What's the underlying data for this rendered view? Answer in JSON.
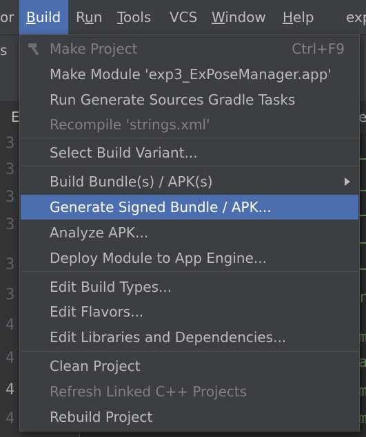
{
  "menubar": {
    "items": [
      {
        "label": "or"
      },
      {
        "label": "Build",
        "underline": "B",
        "rest": "uild"
      },
      {
        "label": "Run",
        "pre": "R",
        "underline": "u",
        "rest": "n"
      },
      {
        "label": "Tools",
        "underline": "T",
        "rest": "ools"
      },
      {
        "label": "VCS"
      },
      {
        "label": "Window",
        "underline": "W",
        "rest": "indow"
      },
      {
        "label": "Help",
        "underline": "H",
        "rest": "elp"
      },
      {
        "label": "exp"
      }
    ]
  },
  "background": {
    "breadcrumb_fragment": "s",
    "tab_fragment": "E",
    "right_fragment": "e",
    "gutter_lines": [
      "3",
      "3",
      "3",
      "3",
      "3",
      "3",
      "4",
      "4",
      "4",
      "4",
      "4"
    ],
    "code_fragments": [
      "r",
      "m",
      "a",
      "m",
      "m"
    ]
  },
  "build_menu": {
    "make_project": {
      "label": "Make Project",
      "shortcut": "Ctrl+F9"
    },
    "make_module": {
      "label": "Make Module 'exp3_ExPoseManager.app'"
    },
    "run_generate_sources": {
      "label": "Run Generate Sources Gradle Tasks"
    },
    "recompile": {
      "label": "Recompile 'strings.xml'"
    },
    "select_build_variant": {
      "label": "Select Build Variant..."
    },
    "build_bundles": {
      "label": "Build Bundle(s) / APK(s)"
    },
    "generate_signed": {
      "label": "Generate Signed Bundle / APK..."
    },
    "analyze_apk": {
      "label": "Analyze APK..."
    },
    "deploy_module": {
      "label": "Deploy Module to App Engine..."
    },
    "edit_build_types": {
      "label": "Edit Build Types..."
    },
    "edit_flavors": {
      "label": "Edit Flavors..."
    },
    "edit_libraries": {
      "label": "Edit Libraries and Dependencies..."
    },
    "clean_project": {
      "label": "Clean Project"
    },
    "refresh_linked": {
      "label": "Refresh Linked C++ Projects"
    },
    "rebuild_project": {
      "label": "Rebuild Project"
    }
  },
  "colors": {
    "selection": "#4b6eaf",
    "menu_bg": "#3c3f41",
    "text": "#bbbbbb",
    "disabled_text": "#808080"
  }
}
